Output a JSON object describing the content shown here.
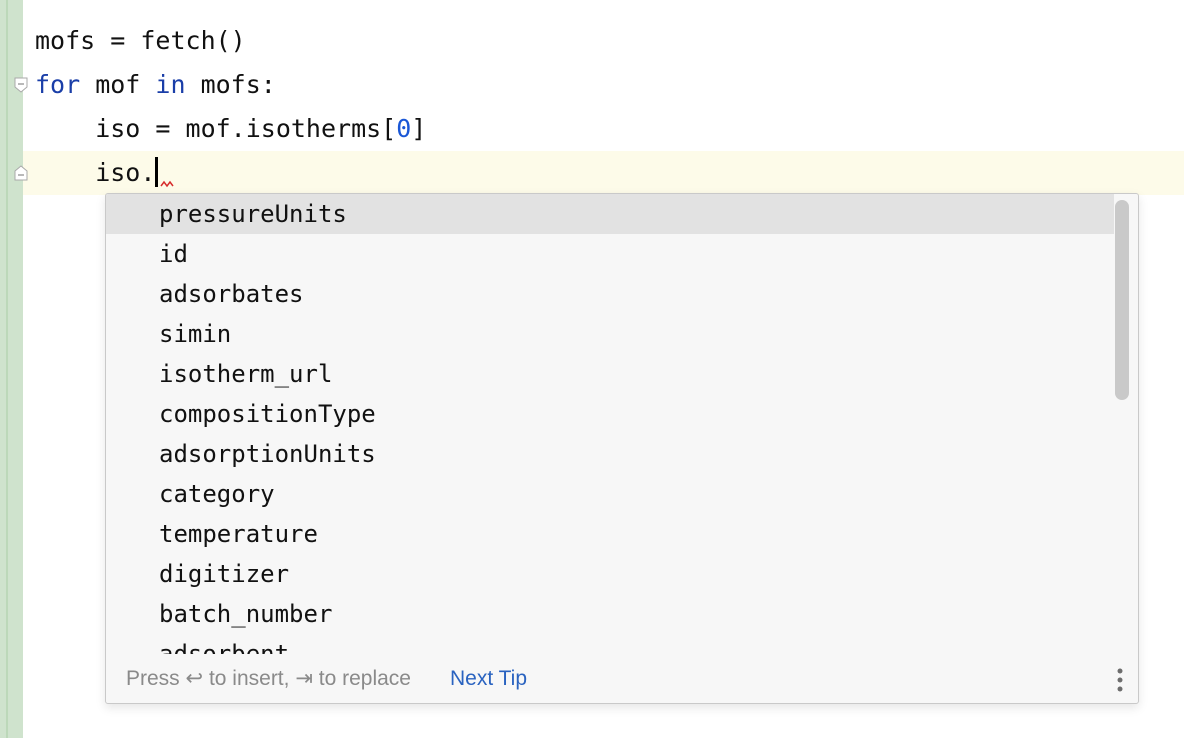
{
  "editor": {
    "lines": [
      {
        "code": "mofs = fetch()"
      },
      {
        "kw1": "for",
        "t1": " mof ",
        "kw2": "in",
        "t2": " mofs:"
      },
      {
        "pre": "    iso = mof.isotherms[",
        "num": "0",
        "post": "]"
      },
      {
        "code": "    iso."
      }
    ]
  },
  "completion": {
    "items": [
      "pressureUnits",
      "id",
      "adsorbates",
      "simin",
      "isotherm_url",
      "compositionType",
      "adsorptionUnits",
      "category",
      "temperature",
      "digitizer",
      "batch_number",
      "adsorbent"
    ],
    "selected_index": 0,
    "footer": {
      "hint": "Press ↩ to insert, ⇥ to replace",
      "next_tip": "Next Tip"
    }
  },
  "colors": {
    "keyword": "#1a3ea8",
    "number": "#1a57d6",
    "link": "#2a63c0",
    "gutter": "#cfe3cd",
    "current_line": "#fdfbe9"
  }
}
